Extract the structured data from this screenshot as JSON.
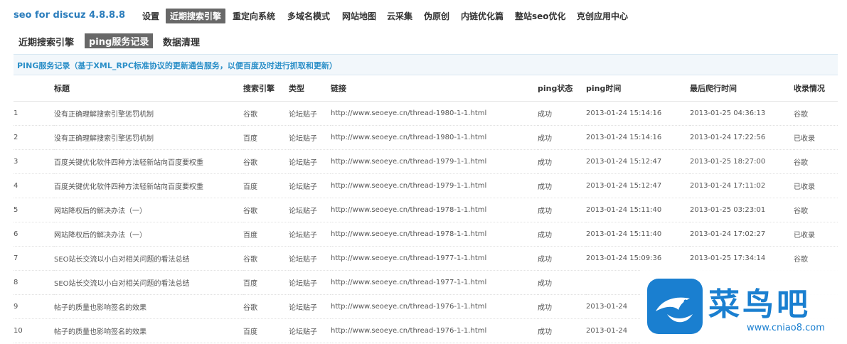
{
  "app": {
    "title": "seo for discuz 4.8.8.8"
  },
  "topnav": [
    "设置",
    "近期搜索引擎",
    "重定向系统",
    "多域名模式",
    "网站地图",
    "云采集",
    "伪原创",
    "内链优化篇",
    "整站seo优化",
    "克创应用中心"
  ],
  "subnav": [
    "近期搜索引擎",
    "ping服务记录",
    "数据清理"
  ],
  "panel": {
    "title": "PING服务记录（基于XML_RPC标准协议的更新通告服务，以便百度及时进行抓取和更新）"
  },
  "table": {
    "headers": [
      "标题",
      "搜索引擎",
      "类型",
      "链接",
      "ping状态",
      "ping时间",
      "最后爬行时间",
      "收录情况"
    ],
    "rows": [
      [
        "1",
        "没有正确理解搜索引擎惩罚机制",
        "谷歌",
        "论坛贴子",
        "http://www.seoeye.cn/thread-1980-1-1.html",
        "成功",
        "2013-01-24 15:14:16",
        "2013-01-25 04:36:13",
        "谷歌"
      ],
      [
        "2",
        "没有正确理解搜索引擎惩罚机制",
        "百度",
        "论坛贴子",
        "http://www.seoeye.cn/thread-1980-1-1.html",
        "成功",
        "2013-01-24 15:14:16",
        "2013-01-24 17:22:56",
        "已收录"
      ],
      [
        "3",
        "百度关键优化软件四种方法轻新站向百度要权重",
        "谷歌",
        "论坛贴子",
        "http://www.seoeye.cn/thread-1979-1-1.html",
        "成功",
        "2013-01-24 15:12:47",
        "2013-01-25 18:27:00",
        "谷歌"
      ],
      [
        "4",
        "百度关键优化软件四种方法轻新站向百度要权重",
        "百度",
        "论坛贴子",
        "http://www.seoeye.cn/thread-1979-1-1.html",
        "成功",
        "2013-01-24 15:12:47",
        "2013-01-24 17:11:02",
        "已收录"
      ],
      [
        "5",
        "网站降权后的解决办法（一）",
        "谷歌",
        "论坛贴子",
        "http://www.seoeye.cn/thread-1978-1-1.html",
        "成功",
        "2013-01-24 15:11:40",
        "2013-01-25 03:23:01",
        "谷歌"
      ],
      [
        "6",
        "网站降权后的解决办法（一）",
        "百度",
        "论坛贴子",
        "http://www.seoeye.cn/thread-1978-1-1.html",
        "成功",
        "2013-01-24 15:11:40",
        "2013-01-24 17:02:27",
        "已收录"
      ],
      [
        "7",
        "SEO站长交流以小白对相关问题的看法总结",
        "谷歌",
        "论坛贴子",
        "http://www.seoeye.cn/thread-1977-1-1.html",
        "成功",
        "2013-01-24 15:09:36",
        "2013-01-25 17:34:14",
        "谷歌"
      ],
      [
        "8",
        "SEO站长交流以小白对相关问题的看法总结",
        "百度",
        "论坛贴子",
        "http://www.seoeye.cn/thread-1977-1-1.html",
        "成功",
        "",
        "",
        ""
      ],
      [
        "9",
        "帖子的质量也影响签名的效果",
        "谷歌",
        "论坛贴子",
        "http://www.seoeye.cn/thread-1976-1-1.html",
        "成功",
        "2013-01-24",
        "",
        ""
      ],
      [
        "10",
        "帖子的质量也影响签名的效果",
        "百度",
        "论坛贴子",
        "http://www.seoeye.cn/thread-1976-1-1.html",
        "成功",
        "2013-01-24",
        "",
        ""
      ]
    ]
  },
  "watermark": {
    "text": "菜鸟吧",
    "url": "www.cniao8.com"
  },
  "colors": {
    "accent": "#2b7dbc",
    "active_tab": "#686868",
    "watermark": "#1a7fd0"
  }
}
